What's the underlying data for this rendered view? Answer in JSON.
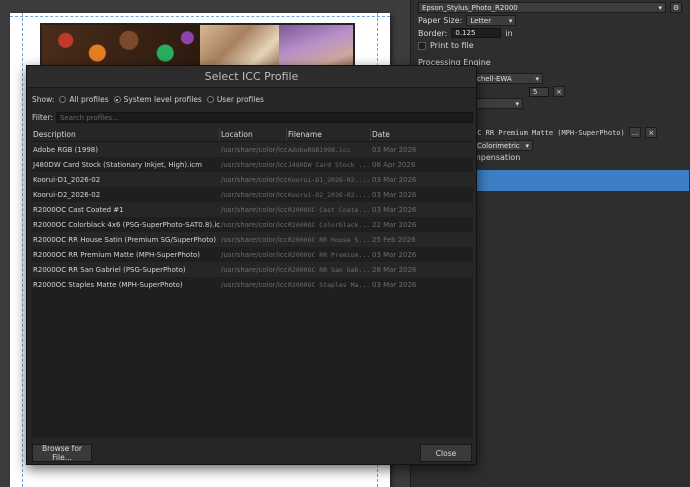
{
  "panel": {
    "printer": "Epson_Stylus_Photo_R2000",
    "paper_size_label": "Paper Size:",
    "paper_size": "Letter",
    "border_label": "Border:",
    "border_value": "0.125",
    "border_unit": "in",
    "print_to_file": "Print to file",
    "processing_engine": "Processing Engine",
    "resample_method": "chell-EWA",
    "resample_value": "5",
    "profile_mono": "0C RR Premium Matte (MPH-SuperPhoto)",
    "profile_more_btn": "...",
    "intent": "Colorimetric",
    "compensation": "mpensation",
    "clear_btn": "×",
    "gear_icon": "gear-icon"
  },
  "dialog": {
    "title": "Select ICC Profile",
    "show_label": "Show:",
    "show_options": [
      "All profiles",
      "System level profiles",
      "User profiles"
    ],
    "show_selected": "System level profiles",
    "filter_label": "Filter:",
    "filter_placeholder": "Search profiles...",
    "columns": [
      "Description",
      "Location",
      "Filename",
      "Date"
    ],
    "rows": [
      [
        "Adobe RGB (1998)",
        "/usr/share/color/icc",
        "AdobeRGB1998.icc",
        "03 Mar 2026"
      ],
      [
        "J480DW Card Stock (Stationary Inkjet, High).icm",
        "/usr/share/color/icc",
        "J480DW Card Stock ...",
        "06 Apr 2026"
      ],
      [
        "Koorui-D1_2026-02",
        "/usr/share/color/icc",
        "Koorui-D1_2026-02....",
        "03 Mar 2026"
      ],
      [
        "Koorui-D2_2026-02",
        "/usr/share/color/icc",
        "Koorui-D2_2026-02....",
        "03 Mar 2026"
      ],
      [
        "R2000OC Cast Coated #1",
        "/usr/share/color/icc",
        "R2000OC Cast Coate...",
        "03 Mar 2026"
      ],
      [
        "R2000OC Colorblack 4x6 (PSG-SuperPhoto-SAT0.8).icm",
        "/usr/share/color/icc",
        "R2000OC Colorblack...",
        "22 Mar 2026"
      ],
      [
        "R2000OC RR House Satin (Premium SG/SuperPhoto)",
        "/usr/share/color/icc",
        "R2000OC RR House S...",
        "25 Feb 2026"
      ],
      [
        "R2000OC RR Premium Matte (MPH-SuperPhoto)",
        "/usr/share/color/icc",
        "R2000OC RR Premium...",
        "03 Mar 2026"
      ],
      [
        "R2000OC RR San Gabriel (PSG-SuperPhoto)",
        "/usr/share/color/icc",
        "R2000OC RR San Gab...",
        "28 Mar 2026"
      ],
      [
        "R2000OC Staples Matte (MPH-SuperPhoto)",
        "/usr/share/color/icc",
        "R2000OC Staples Ma...",
        "03 Mar 2026"
      ]
    ],
    "browse_btn": "Browse for File...",
    "close_btn": "Close"
  }
}
